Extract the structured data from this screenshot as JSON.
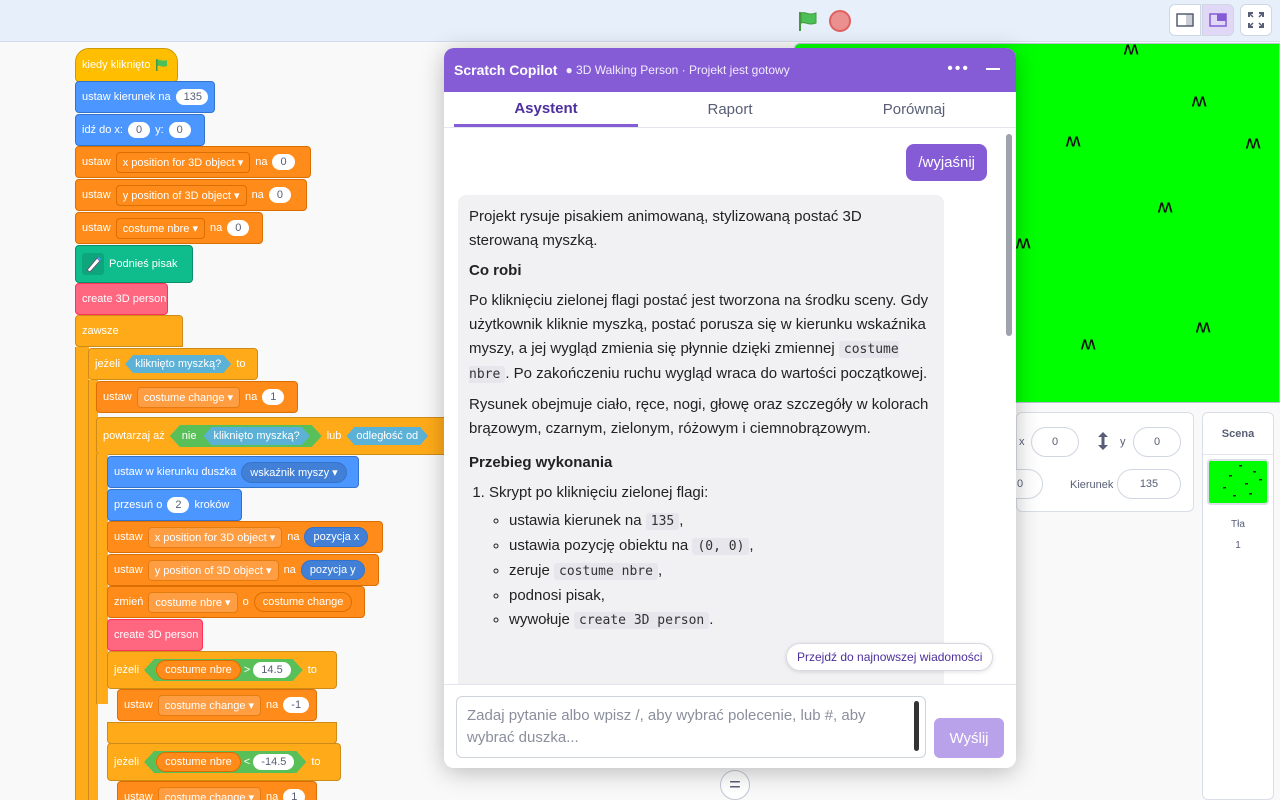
{
  "toolbar": {
    "flag_icon": "green-flag-icon",
    "stop_icon": "stop-icon"
  },
  "code": {
    "when_clicked": "kiedy kliknięto",
    "set_direction": "ustaw kierunek na",
    "dir_value": "135",
    "goto": "idź do x:",
    "goto_x": "0",
    "goto_y_label": "y:",
    "goto_y": "0",
    "set": "ustaw",
    "to": "na",
    "var_x": "x position for 3D object",
    "var_y": "y position of 3D object",
    "var_costume": "costume nbre",
    "zero": "0",
    "pen_up": "Podnieś pisak",
    "create_person": "create 3D person",
    "forever": "zawsze",
    "if": "jeżeli",
    "mouse_down": "kliknięto myszką?",
    "then": "to",
    "var_change": "costume change",
    "one": "1",
    "repeat_until": "powtarzaj aż",
    "not": "nie",
    "or": "lub",
    "distance": "odległość od",
    "point_towards": "ustaw w kierunku duszka",
    "mouse_pointer": "wskaźnik myszy",
    "move": "przesuń o",
    "move_steps": "2",
    "steps": "kroków",
    "x_position": "x position for 3D object",
    "y_position": "y position of 3D object",
    "pos_x": "pozycja x",
    "pos_y": "pozycja y",
    "change": "zmień",
    "by": "o",
    "gt": ">",
    "lt": "<",
    "val_145": "14.5",
    "val_neg145": "-14.5",
    "neg_one": "-1"
  },
  "copilot": {
    "title": "Scratch Copilot",
    "project": "● 3D Walking Person · Projekt jest gotowy",
    "tabs": [
      "Asystent",
      "Raport",
      "Porównaj"
    ],
    "user_message": "/wyjaśnij",
    "intro": "Projekt rysuje pisakiem animowaną, stylizowaną postać 3D sterowaną myszką.",
    "h_what": "Co robi",
    "p_what_1": "Po kliknięciu zielonej flagi postać jest tworzona na środku sceny. Gdy użytkownik kliknie myszką, postać porusza się w kierunku wskaźnika myszy, a jej wygląd zmienia się płynnie dzięki zmiennej",
    "p_what_code": "costume nbre",
    "p_what_2": ". Po zakończeniu ruchu wygląd wraca do wartości początkowej.",
    "p_drawing": "Rysunek obejmuje ciało, ręce, nogi, głowę oraz szczegóły w kolorach brązowym, czarnym, zielonym, różowym i ciemnobrązowym.",
    "h_flow": "Przebieg wykonania",
    "step1": "Skrypt po kliknięciu zielonej flagi:",
    "s1_text": "ustawia kierunek na",
    "s1_code": "135",
    "s2_text": "ustawia pozycję obiektu na",
    "s2_code": "(0, 0)",
    "s3_text": "zeruje",
    "s3_code": "costume nbre",
    "s4_text": "podnosi pisak,",
    "s5_text": "wywołuje",
    "s5_code": "create 3D person",
    "jump_latest": "Przejdź do najnowszej wiadomości",
    "input_placeholder": "Zadaj pytanie albo wpisz /, aby wybrać polecenie, lub #, aby wybrać duszka...",
    "send": "Wyślij"
  },
  "sprite_info": {
    "x_label": "x",
    "x_value": "0",
    "y_label": "y",
    "y_value": "0",
    "size_value": "0",
    "direction_label": "Kierunek",
    "direction_value": "135"
  },
  "stage_panel": {
    "label": "Scena",
    "backdrops_label": "Tła",
    "backdrops_count": "1"
  },
  "colors": {
    "accent": "#855cd6",
    "stage_bg": "#00ff00"
  }
}
